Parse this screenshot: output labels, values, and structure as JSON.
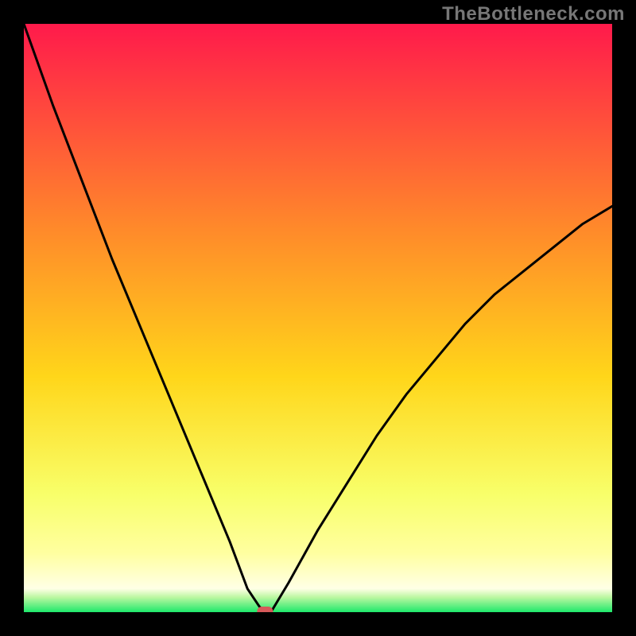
{
  "watermark": "TheBottleneck.com",
  "chart_data": {
    "type": "line",
    "title": "",
    "xlabel": "",
    "ylabel": "",
    "xlim": [
      0,
      100
    ],
    "ylim": [
      0,
      100
    ],
    "grid": false,
    "series": [
      {
        "name": "bottleneck-curve",
        "x": [
          0,
          5,
          10,
          15,
          20,
          25,
          30,
          35,
          38,
          40,
          41,
          42,
          45,
          50,
          55,
          60,
          65,
          70,
          75,
          80,
          85,
          90,
          95,
          100
        ],
        "y": [
          100,
          86,
          73,
          60,
          48,
          36,
          24,
          12,
          4,
          1,
          0,
          0,
          5,
          14,
          22,
          30,
          37,
          43,
          49,
          54,
          58,
          62,
          66,
          69
        ]
      }
    ],
    "marker": {
      "x": 41,
      "y": 0
    },
    "green_band": {
      "y_start": 0,
      "y_end": 3
    },
    "gradient_stops": [
      {
        "offset": 0.0,
        "color": "#ff1a4b"
      },
      {
        "offset": 0.35,
        "color": "#ff8a2a"
      },
      {
        "offset": 0.6,
        "color": "#ffd61a"
      },
      {
        "offset": 0.8,
        "color": "#f8ff6a"
      },
      {
        "offset": 0.9,
        "color": "#ffffa0"
      },
      {
        "offset": 0.96,
        "color": "#ffffe6"
      },
      {
        "offset": 0.975,
        "color": "#baf7a0"
      },
      {
        "offset": 1.0,
        "color": "#1ee86b"
      }
    ]
  }
}
